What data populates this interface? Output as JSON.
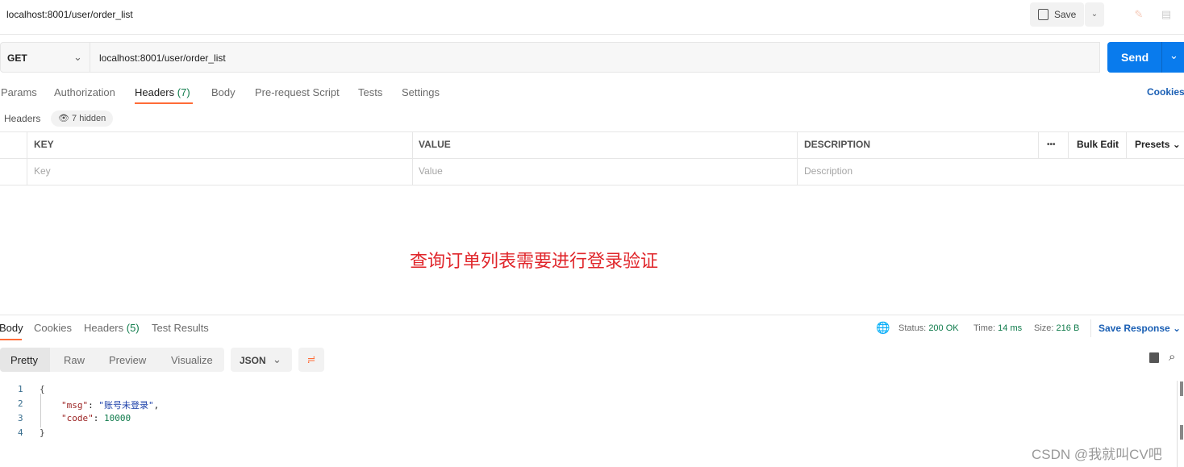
{
  "header": {
    "title": "localhost:8001/user/order_list",
    "save_label": "Save"
  },
  "request": {
    "method": "GET",
    "url": "localhost:8001/user/order_list",
    "send_label": "Send"
  },
  "tabs": [
    {
      "label": "Params"
    },
    {
      "label": "Authorization"
    },
    {
      "label": "Headers",
      "count": "(7)"
    },
    {
      "label": "Body"
    },
    {
      "label": "Pre-request Script"
    },
    {
      "label": "Tests"
    },
    {
      "label": "Settings"
    }
  ],
  "cookies_label": "Cookies",
  "headers_section": {
    "label": "Headers",
    "hidden": "7 hidden"
  },
  "table": {
    "columns": [
      "KEY",
      "VALUE",
      "DESCRIPTION"
    ],
    "more": "•••",
    "bulk_edit": "Bulk Edit",
    "presets": "Presets",
    "placeholders": [
      "Key",
      "Value",
      "Description"
    ]
  },
  "annotation": {
    "text": "查询订单列表需要进行登录验证",
    "color": "#e0262b"
  },
  "response": {
    "tabs": [
      {
        "label": "Body"
      },
      {
        "label": "Cookies"
      },
      {
        "label": "Headers",
        "count": "(5)"
      },
      {
        "label": "Test Results"
      }
    ],
    "status_label": "Status:",
    "status": "200 OK",
    "time_label": "Time:",
    "time": "14 ms",
    "size_label": "Size:",
    "size": "216 B",
    "save_response": "Save Response",
    "views": [
      "Pretty",
      "Raw",
      "Preview",
      "Visualize"
    ],
    "format": "JSON",
    "lines": [
      "1",
      "2",
      "3",
      "4"
    ],
    "code": {
      "open": "{",
      "msg_key": "\"msg\"",
      "msg_val": "\"账号未登录\"",
      "code_key": "\"code\"",
      "code_val": "10000",
      "close": "}"
    }
  },
  "watermark": "CSDN @我就叫CV吧",
  "colors": {
    "accent": "#097bed",
    "tab_underline": "#ff6c37",
    "status_green": "#0f7b4b"
  }
}
